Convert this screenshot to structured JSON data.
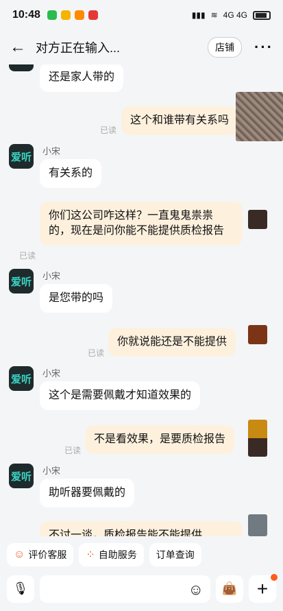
{
  "status_bar": {
    "time": "10:48",
    "network": "4G 4G",
    "battery": "bolt"
  },
  "header": {
    "title": "对方正在输入...",
    "shop_label": "店铺"
  },
  "messages": [
    {
      "side": "left",
      "text": "还是家人带的"
    },
    {
      "side": "right",
      "text": "这个和谁带有关系吗",
      "read": "已读"
    },
    {
      "side": "left",
      "name": "小宋",
      "avatar": "爱听",
      "text": "有关系的"
    },
    {
      "side": "right",
      "text": "你们这公司咋这样？一直鬼鬼祟祟的，现在是问你能不能提供质检报告",
      "read": "已读"
    },
    {
      "side": "left",
      "name": "小宋",
      "avatar": "爱听",
      "text": "是您带的吗"
    },
    {
      "side": "right",
      "text": "你就说能还是不能提供",
      "read": "已读"
    },
    {
      "side": "left",
      "name": "小宋",
      "avatar": "爱听",
      "text": "这个是需要佩戴才知道效果的"
    },
    {
      "side": "right",
      "text": "不是看效果，是要质检报告",
      "read": "已读"
    },
    {
      "side": "left",
      "name": "小宋",
      "avatar": "爱听",
      "text": "助听器要佩戴的"
    },
    {
      "side": "right",
      "text": "不讨一谈，质检报告能不能提供"
    }
  ],
  "quick_actions": [
    "评价客服",
    "自助服务",
    "订单查询"
  ],
  "colors": {
    "user_bubble": "#fdf1de",
    "agent_bubble": "#ffffff",
    "background": "#f4f5f7",
    "badge": "#ff5a1f"
  },
  "icons": {
    "back": "arrow-left-icon",
    "more": "more-dots-icon",
    "mic": "voice-icon",
    "emoji": "smile-icon",
    "bag": "shopping-bag-icon",
    "plus": "plus-icon"
  }
}
